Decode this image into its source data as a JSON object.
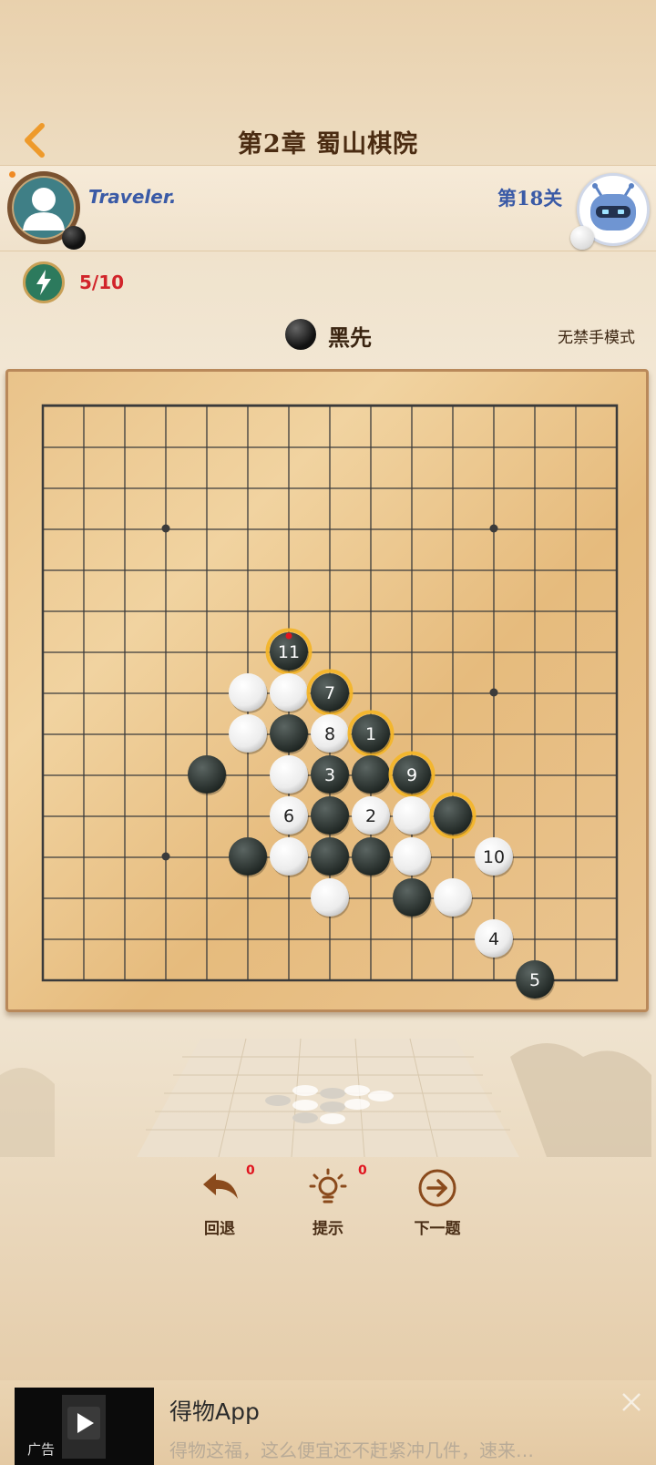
{
  "header": {
    "title": "第2章 蜀山棋院"
  },
  "player": {
    "name": "Traveler.",
    "stone": "black"
  },
  "opponent": {
    "level": "第18关",
    "stone": "white"
  },
  "energy": {
    "count": "5/10"
  },
  "turn": {
    "label": "黑先",
    "mode": "无禁手模式"
  },
  "board": {
    "size": 15,
    "star_points": [
      [
        3,
        3
      ],
      [
        3,
        11
      ],
      [
        11,
        3
      ],
      [
        11,
        7
      ]
    ],
    "stones": [
      {
        "col": 6,
        "row": 6,
        "color": "black",
        "number": "11",
        "highlight": true
      },
      {
        "col": 5,
        "row": 7,
        "color": "white",
        "number": "",
        "highlight": false
      },
      {
        "col": 6,
        "row": 7,
        "color": "white",
        "number": "",
        "highlight": false
      },
      {
        "col": 7,
        "row": 7,
        "color": "black",
        "number": "7",
        "highlight": true
      },
      {
        "col": 5,
        "row": 8,
        "color": "white",
        "number": "",
        "highlight": false
      },
      {
        "col": 6,
        "row": 8,
        "color": "black",
        "number": "",
        "highlight": false
      },
      {
        "col": 7,
        "row": 8,
        "color": "white",
        "number": "8",
        "highlight": false
      },
      {
        "col": 8,
        "row": 8,
        "color": "black",
        "number": "1",
        "highlight": true
      },
      {
        "col": 4,
        "row": 9,
        "color": "black",
        "number": "",
        "highlight": false
      },
      {
        "col": 6,
        "row": 9,
        "color": "white",
        "number": "",
        "highlight": false
      },
      {
        "col": 7,
        "row": 9,
        "color": "black",
        "number": "3",
        "highlight": false
      },
      {
        "col": 8,
        "row": 9,
        "color": "black",
        "number": "",
        "highlight": false
      },
      {
        "col": 9,
        "row": 9,
        "color": "black",
        "number": "9",
        "highlight": true
      },
      {
        "col": 6,
        "row": 10,
        "color": "white",
        "number": "6",
        "highlight": false
      },
      {
        "col": 7,
        "row": 10,
        "color": "black",
        "number": "",
        "highlight": false
      },
      {
        "col": 8,
        "row": 10,
        "color": "white",
        "number": "2",
        "highlight": false
      },
      {
        "col": 9,
        "row": 10,
        "color": "white",
        "number": "",
        "highlight": false
      },
      {
        "col": 10,
        "row": 10,
        "color": "black",
        "number": "",
        "highlight": true
      },
      {
        "col": 5,
        "row": 11,
        "color": "black",
        "number": "",
        "highlight": false
      },
      {
        "col": 6,
        "row": 11,
        "color": "white",
        "number": "",
        "highlight": false
      },
      {
        "col": 7,
        "row": 11,
        "color": "black",
        "number": "",
        "highlight": false
      },
      {
        "col": 8,
        "row": 11,
        "color": "black",
        "number": "",
        "highlight": false
      },
      {
        "col": 9,
        "row": 11,
        "color": "white",
        "number": "",
        "highlight": false
      },
      {
        "col": 11,
        "row": 11,
        "color": "white",
        "number": "10",
        "highlight": false
      },
      {
        "col": 7,
        "row": 12,
        "color": "white",
        "number": "",
        "highlight": false
      },
      {
        "col": 9,
        "row": 12,
        "color": "black",
        "number": "",
        "highlight": false
      },
      {
        "col": 10,
        "row": 12,
        "color": "white",
        "number": "",
        "highlight": false
      },
      {
        "col": 11,
        "row": 13,
        "color": "white",
        "number": "4",
        "highlight": false
      },
      {
        "col": 12,
        "row": 14,
        "color": "black",
        "number": "5",
        "highlight": false
      }
    ]
  },
  "actions": [
    {
      "id": "undo",
      "label": "回退",
      "badge": "0"
    },
    {
      "id": "hint",
      "label": "提示",
      "badge": "0"
    },
    {
      "id": "next",
      "label": "下一题",
      "badge": ""
    }
  ],
  "ad": {
    "title": "得物App",
    "description": "得物这福，这么便宜还不赶紧冲几件，速来…",
    "tag": "广告"
  },
  "colors": {
    "accent": "#3a5aa6",
    "badge": "#e0151f",
    "highlight": "#f3b52a"
  }
}
